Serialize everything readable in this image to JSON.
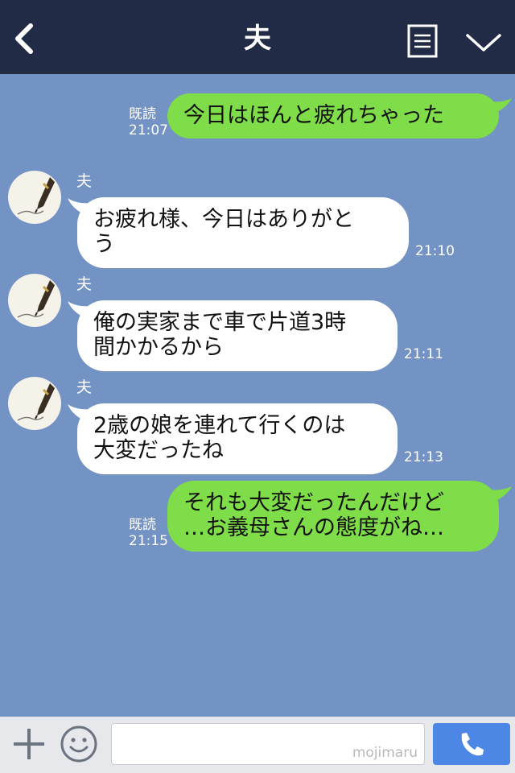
{
  "header": {
    "title": "夫"
  },
  "messages": [
    {
      "side": "right",
      "read": "既読",
      "time": "21:07",
      "text": "今日はほんと疲れちゃった"
    },
    {
      "side": "left",
      "sender": "夫",
      "time": "21:10",
      "line1": "お疲れ様、今日はありがと",
      "line2": "う"
    },
    {
      "side": "left",
      "sender": "夫",
      "time": "21:11",
      "line1": "俺の実家まで車で片道3時",
      "line2": "間かかるから"
    },
    {
      "side": "left",
      "sender": "夫",
      "time": "21:13",
      "line1": "2歳の娘を連れて行くのは",
      "line2": "大変だったね"
    },
    {
      "side": "right",
      "read": "既読",
      "time": "21:15",
      "line1": "それも大変だったんだけど",
      "line2": "…お義母さんの態度がね…"
    }
  ],
  "input": {
    "watermark": "mojimaru"
  },
  "colors": {
    "header_bg": "#222b45",
    "chat_bg": "#7393c4",
    "green_bubble": "#7edd48",
    "send_button": "#4c87e6"
  },
  "icons": [
    "back-icon",
    "menu-icon",
    "chevron-down-icon",
    "plus-icon",
    "smile-icon",
    "phone-icon",
    "fountain-pen-avatar-icon"
  ]
}
